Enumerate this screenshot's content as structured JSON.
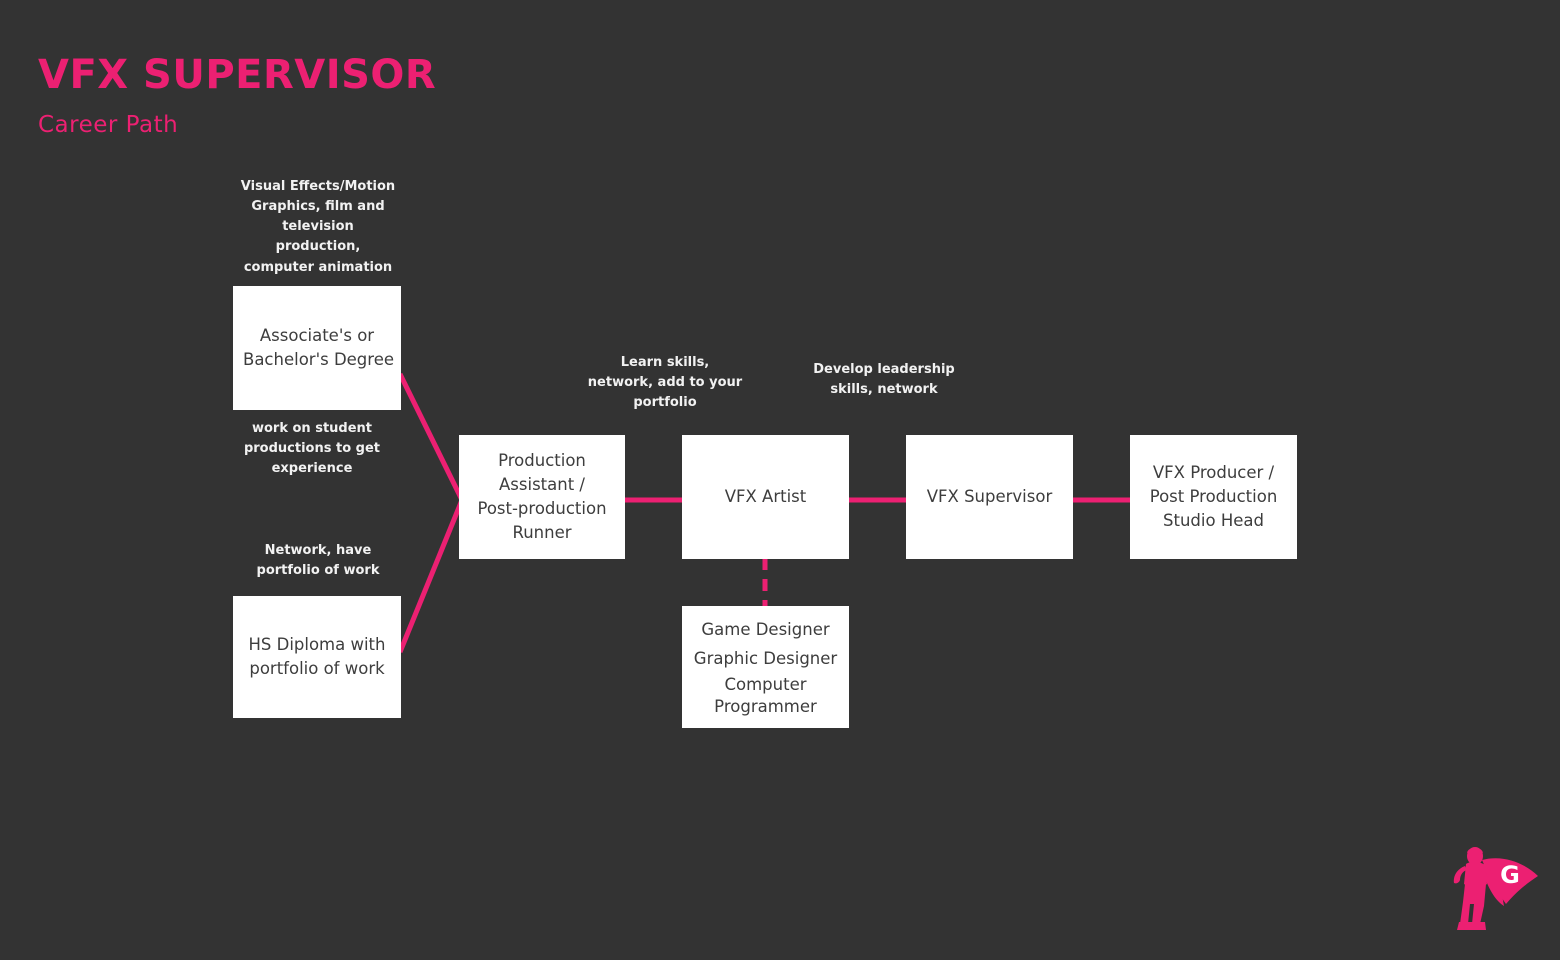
{
  "header": {
    "title": "VFX SUPERVISOR",
    "subtitle": "Career Path"
  },
  "colors": {
    "background": "#333333",
    "accent_pink": "#ec2072",
    "node_fill": "#ffffff",
    "node_text": "#3d3d3d",
    "annotation_text": "#f2f2f2"
  },
  "nodes": {
    "degree": {
      "lines": [
        "Associate's or",
        "Bachelor's Degree"
      ]
    },
    "hs_diploma": {
      "lines": [
        "HS Diploma with",
        "portfolio of work"
      ]
    },
    "production_assistant": {
      "lines": [
        "Production",
        "Assistant /",
        "Post-production",
        "Runner"
      ]
    },
    "vfx_artist": {
      "lines": [
        "VFX Artist"
      ]
    },
    "vfx_supervisor": {
      "lines": [
        "VFX Supervisor"
      ]
    },
    "vfx_producer": {
      "lines": [
        "VFX Producer /",
        "Post Production",
        "Studio Head"
      ]
    },
    "alternate_careers": {
      "lines": [
        "Game Designer",
        "Graphic Designer",
        "Computer",
        "Programmer"
      ]
    }
  },
  "annotations": {
    "degree_fields": {
      "lines": [
        "Visual Effects/Motion",
        "Graphics, film and",
        "television",
        "production,",
        "computer animation"
      ]
    },
    "student_productions": {
      "lines": [
        "work on student",
        "productions to get",
        "experience"
      ]
    },
    "network_portfolio": {
      "lines": [
        "Network, have",
        "portfolio of work"
      ]
    },
    "learn_skills": {
      "lines": [
        "Learn skills,",
        "network, add to your",
        "portfolio"
      ]
    },
    "develop_leadership": {
      "lines": [
        "Develop leadership",
        "skills, network"
      ]
    }
  },
  "logo": {
    "letter": "G",
    "name": "superhero-logo"
  }
}
